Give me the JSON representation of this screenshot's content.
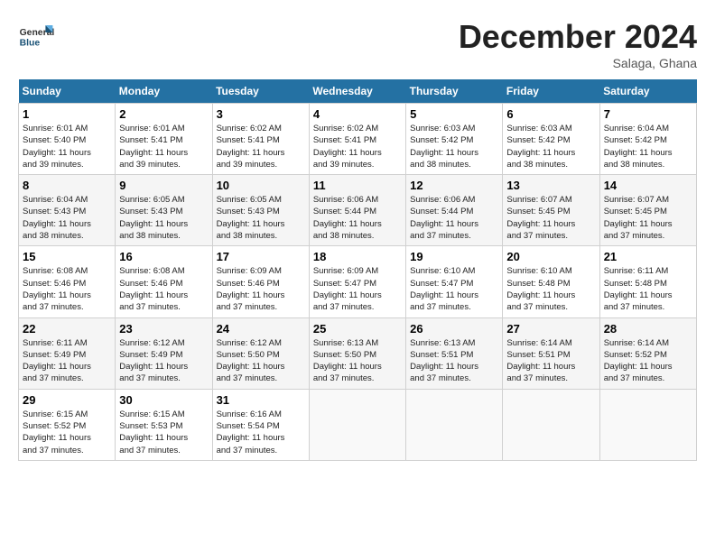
{
  "header": {
    "logo_general": "General",
    "logo_blue": "Blue",
    "month_title": "December 2024",
    "location": "Salaga, Ghana"
  },
  "days_of_week": [
    "Sunday",
    "Monday",
    "Tuesday",
    "Wednesday",
    "Thursday",
    "Friday",
    "Saturday"
  ],
  "weeks": [
    [
      {
        "day": 1,
        "info": "Sunrise: 6:01 AM\nSunset: 5:40 PM\nDaylight: 11 hours\nand 39 minutes."
      },
      {
        "day": 2,
        "info": "Sunrise: 6:01 AM\nSunset: 5:41 PM\nDaylight: 11 hours\nand 39 minutes."
      },
      {
        "day": 3,
        "info": "Sunrise: 6:02 AM\nSunset: 5:41 PM\nDaylight: 11 hours\nand 39 minutes."
      },
      {
        "day": 4,
        "info": "Sunrise: 6:02 AM\nSunset: 5:41 PM\nDaylight: 11 hours\nand 39 minutes."
      },
      {
        "day": 5,
        "info": "Sunrise: 6:03 AM\nSunset: 5:42 PM\nDaylight: 11 hours\nand 38 minutes."
      },
      {
        "day": 6,
        "info": "Sunrise: 6:03 AM\nSunset: 5:42 PM\nDaylight: 11 hours\nand 38 minutes."
      },
      {
        "day": 7,
        "info": "Sunrise: 6:04 AM\nSunset: 5:42 PM\nDaylight: 11 hours\nand 38 minutes."
      }
    ],
    [
      {
        "day": 8,
        "info": "Sunrise: 6:04 AM\nSunset: 5:43 PM\nDaylight: 11 hours\nand 38 minutes."
      },
      {
        "day": 9,
        "info": "Sunrise: 6:05 AM\nSunset: 5:43 PM\nDaylight: 11 hours\nand 38 minutes."
      },
      {
        "day": 10,
        "info": "Sunrise: 6:05 AM\nSunset: 5:43 PM\nDaylight: 11 hours\nand 38 minutes."
      },
      {
        "day": 11,
        "info": "Sunrise: 6:06 AM\nSunset: 5:44 PM\nDaylight: 11 hours\nand 38 minutes."
      },
      {
        "day": 12,
        "info": "Sunrise: 6:06 AM\nSunset: 5:44 PM\nDaylight: 11 hours\nand 37 minutes."
      },
      {
        "day": 13,
        "info": "Sunrise: 6:07 AM\nSunset: 5:45 PM\nDaylight: 11 hours\nand 37 minutes."
      },
      {
        "day": 14,
        "info": "Sunrise: 6:07 AM\nSunset: 5:45 PM\nDaylight: 11 hours\nand 37 minutes."
      }
    ],
    [
      {
        "day": 15,
        "info": "Sunrise: 6:08 AM\nSunset: 5:46 PM\nDaylight: 11 hours\nand 37 minutes."
      },
      {
        "day": 16,
        "info": "Sunrise: 6:08 AM\nSunset: 5:46 PM\nDaylight: 11 hours\nand 37 minutes."
      },
      {
        "day": 17,
        "info": "Sunrise: 6:09 AM\nSunset: 5:46 PM\nDaylight: 11 hours\nand 37 minutes."
      },
      {
        "day": 18,
        "info": "Sunrise: 6:09 AM\nSunset: 5:47 PM\nDaylight: 11 hours\nand 37 minutes."
      },
      {
        "day": 19,
        "info": "Sunrise: 6:10 AM\nSunset: 5:47 PM\nDaylight: 11 hours\nand 37 minutes."
      },
      {
        "day": 20,
        "info": "Sunrise: 6:10 AM\nSunset: 5:48 PM\nDaylight: 11 hours\nand 37 minutes."
      },
      {
        "day": 21,
        "info": "Sunrise: 6:11 AM\nSunset: 5:48 PM\nDaylight: 11 hours\nand 37 minutes."
      }
    ],
    [
      {
        "day": 22,
        "info": "Sunrise: 6:11 AM\nSunset: 5:49 PM\nDaylight: 11 hours\nand 37 minutes."
      },
      {
        "day": 23,
        "info": "Sunrise: 6:12 AM\nSunset: 5:49 PM\nDaylight: 11 hours\nand 37 minutes."
      },
      {
        "day": 24,
        "info": "Sunrise: 6:12 AM\nSunset: 5:50 PM\nDaylight: 11 hours\nand 37 minutes."
      },
      {
        "day": 25,
        "info": "Sunrise: 6:13 AM\nSunset: 5:50 PM\nDaylight: 11 hours\nand 37 minutes."
      },
      {
        "day": 26,
        "info": "Sunrise: 6:13 AM\nSunset: 5:51 PM\nDaylight: 11 hours\nand 37 minutes."
      },
      {
        "day": 27,
        "info": "Sunrise: 6:14 AM\nSunset: 5:51 PM\nDaylight: 11 hours\nand 37 minutes."
      },
      {
        "day": 28,
        "info": "Sunrise: 6:14 AM\nSunset: 5:52 PM\nDaylight: 11 hours\nand 37 minutes."
      }
    ],
    [
      {
        "day": 29,
        "info": "Sunrise: 6:15 AM\nSunset: 5:52 PM\nDaylight: 11 hours\nand 37 minutes."
      },
      {
        "day": 30,
        "info": "Sunrise: 6:15 AM\nSunset: 5:53 PM\nDaylight: 11 hours\nand 37 minutes."
      },
      {
        "day": 31,
        "info": "Sunrise: 6:16 AM\nSunset: 5:54 PM\nDaylight: 11 hours\nand 37 minutes."
      },
      null,
      null,
      null,
      null
    ]
  ]
}
